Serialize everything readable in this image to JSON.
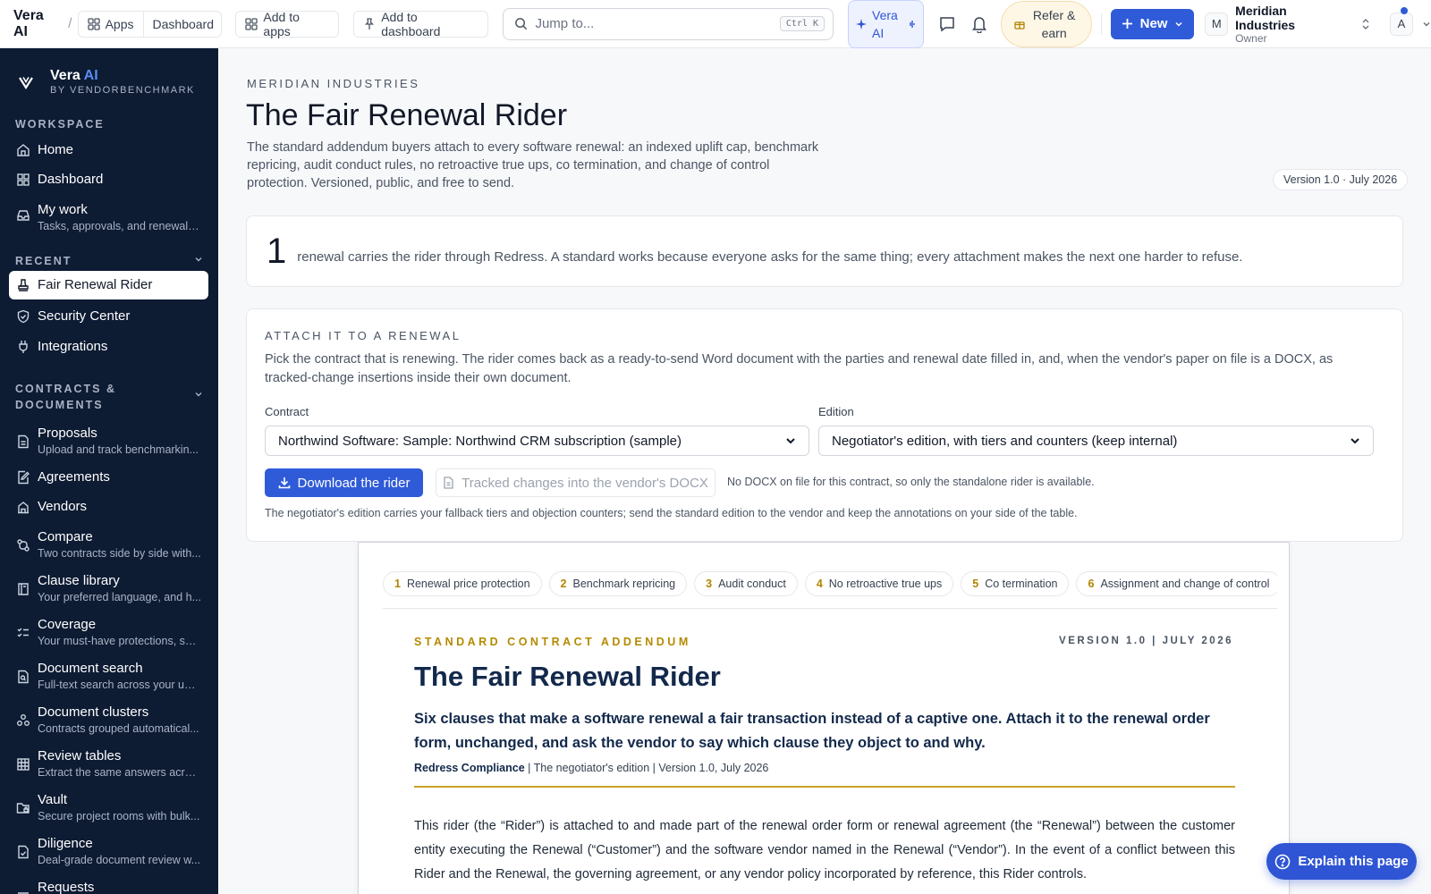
{
  "topbar": {
    "brand": "Vera AI",
    "separator": "/",
    "apps_label": "Apps",
    "dashboard_label": "Dashboard",
    "add_to_apps": "Add to apps",
    "add_to_dashboard": "Add to dashboard",
    "search_placeholder": "Jump to...",
    "search_shortcut": "Ctrl K",
    "vera_label": "Vera AI",
    "refer_label": "Refer & earn",
    "new_label": "New",
    "org_initial": "M",
    "org_name": "Meridian Industries",
    "org_role": "Owner",
    "user_initial": "A",
    "accent": "#2f5bd8"
  },
  "sidebar": {
    "brand_name": "Vera",
    "brand_ai": "AI",
    "brand_sub": "BY VENDORBENCHMARK",
    "workspace_label": "WORKSPACE",
    "recent_label": "RECENT",
    "contracts_label_1": "CONTRACTS &",
    "contracts_label_2": "DOCUMENTS",
    "items": [
      {
        "label": "Home",
        "icon": "home-icon"
      },
      {
        "label": "Dashboard",
        "icon": "grid-icon"
      },
      {
        "label": "My work",
        "sub": "Tasks, approvals, and renewals ...",
        "icon": "inbox-icon"
      },
      {
        "label": "Fair Renewal Rider",
        "icon": "stamp-icon"
      },
      {
        "label": "Security Center",
        "icon": "shield-icon"
      },
      {
        "label": "Integrations",
        "icon": "plug-icon"
      },
      {
        "label": "Proposals",
        "sub": "Upload and track benchmarkin...",
        "icon": "file-icon"
      },
      {
        "label": "Agreements",
        "icon": "pen-file-icon"
      },
      {
        "label": "Vendors",
        "icon": "building-icon"
      },
      {
        "label": "Compare",
        "sub": "Two contracts side by side with...",
        "icon": "compare-icon"
      },
      {
        "label": "Clause library",
        "sub": "Your preferred language, and h...",
        "icon": "book-icon"
      },
      {
        "label": "Coverage",
        "sub": "Your must-have protections, sw...",
        "icon": "checklist-icon"
      },
      {
        "label": "Document search",
        "sub": "Full-text search across your upl...",
        "icon": "file-search-icon"
      },
      {
        "label": "Document clusters",
        "sub": "Contracts grouped automatical...",
        "icon": "cluster-icon"
      },
      {
        "label": "Review tables",
        "sub": "Extract the same answers acros...",
        "icon": "table-icon"
      },
      {
        "label": "Vault",
        "sub": "Secure project rooms with bulk...",
        "icon": "folder-lock-icon"
      },
      {
        "label": "Diligence",
        "sub": "Deal-grade document review w...",
        "icon": "file-check-icon"
      },
      {
        "label": "Requests",
        "icon": "list-icon"
      }
    ]
  },
  "main": {
    "eyebrow": "MERIDIAN INDUSTRIES",
    "title": "The Fair Renewal Rider",
    "description": "The standard addendum buyers attach to every software renewal: an indexed uplift cap, benchmark repricing, audit conduct rules, no retroactive true ups, co termination, and change of control protection. Versioned, public, and free to send.",
    "version_pill": "Version 1.0 · July 2026",
    "stat_number": "1",
    "stat_text": "renewal carries the rider through Redress. A standard works because everyone asks for the same thing; every attachment makes the next one harder to refuse."
  },
  "attach": {
    "title": "ATTACH IT TO A RENEWAL",
    "description": "Pick the contract that is renewing. The rider comes back as a ready-to-send Word document with the parties and renewal date filled in, and, when the vendor's paper on file is a DOCX, as tracked-change insertions inside their own document.",
    "contract_label": "Contract",
    "contract_value": "Northwind Software: Sample: Northwind CRM subscription (sample)",
    "edition_label": "Edition",
    "edition_value": "Negotiator's edition, with tiers and counters (keep internal)",
    "download_label": "Download the rider",
    "tracked_label": "Tracked changes into the vendor's DOCX",
    "no_docx_note": "No DOCX on file for this contract, so only the standalone rider is available.",
    "footnote": "The negotiator's edition carries your fallback tiers and objection counters; send the standard edition to the vendor and keep the annotations on your side of the table."
  },
  "document": {
    "chips": [
      {
        "n": "1",
        "label": "Renewal price protection"
      },
      {
        "n": "2",
        "label": "Benchmark repricing"
      },
      {
        "n": "3",
        "label": "Audit conduct"
      },
      {
        "n": "4",
        "label": "No retroactive true ups"
      },
      {
        "n": "5",
        "label": "Co termination"
      },
      {
        "n": "6",
        "label": "Assignment and change of control"
      }
    ],
    "eyebrow": "STANDARD CONTRACT ADDENDUM",
    "version": "VERSION 1.0 | JULY 2026",
    "title": "The Fair Renewal Rider",
    "lede": "Six clauses that make a software renewal a fair transaction instead of a captive one. Attach it to the renewal order form, unchanged, and ask the vendor to say which clause they object to and why.",
    "meta_org": "Redress Compliance",
    "meta_rest": " | The negotiator's edition | Version 1.0, July 2026",
    "body": "This rider (the “Rider”) is attached to and made part of the renewal order form or renewal agreement (the “Renewal”) between the customer entity executing the Renewal (“Customer”) and the software vendor named in the Renewal (“Vendor”). In the event of a conflict between this Rider and the Renewal, the governing agreement, or any vendor policy incorporated by reference, this Rider controls."
  },
  "explain_label": "Explain this page"
}
